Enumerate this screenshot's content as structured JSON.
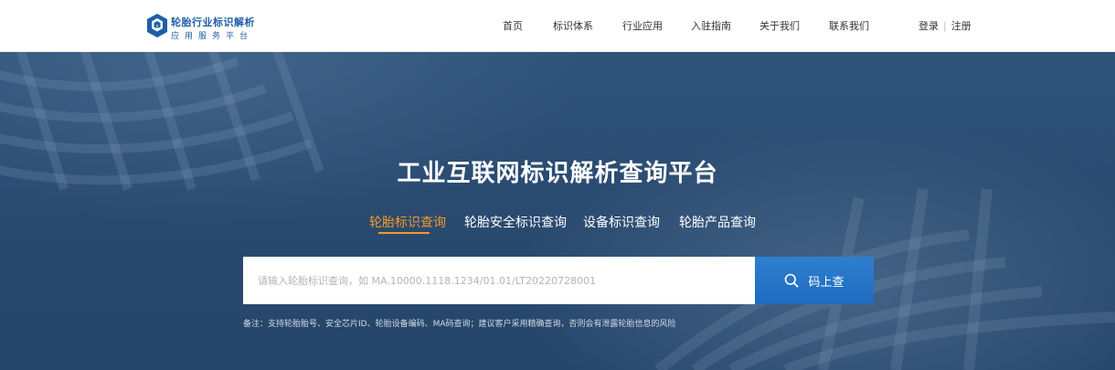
{
  "brand": {
    "title": "轮胎行业标识解析",
    "subtitle": "应用服务平台",
    "accent": "#1f5fa8"
  },
  "nav": {
    "items": [
      {
        "label": "首页"
      },
      {
        "label": "标识体系"
      },
      {
        "label": "行业应用"
      },
      {
        "label": "入驻指南"
      },
      {
        "label": "关于我们"
      },
      {
        "label": "联系我们"
      }
    ],
    "login": "登录",
    "register": "注册"
  },
  "hero": {
    "title": "工业互联网标识解析查询平台",
    "tabs": [
      {
        "label": "轮胎标识查询",
        "active": true
      },
      {
        "label": "轮胎安全标识查询",
        "active": false
      },
      {
        "label": "设备标识查询",
        "active": false
      },
      {
        "label": "轮胎产品查询",
        "active": false
      }
    ],
    "active_tab_color": "#f39a2c",
    "search": {
      "value": "",
      "placeholder": "请输入轮胎标识查询，如 MA.10000.1118.1234/01.01/LT20220728001",
      "button_label": "码上查",
      "button_icon": "search-icon"
    },
    "note": "备注：支持轮胎胎号、安全芯片ID、轮胎设备编码、MA码查询；建议客户采用精确查询，否则会有泄露轮胎信息的风险"
  }
}
